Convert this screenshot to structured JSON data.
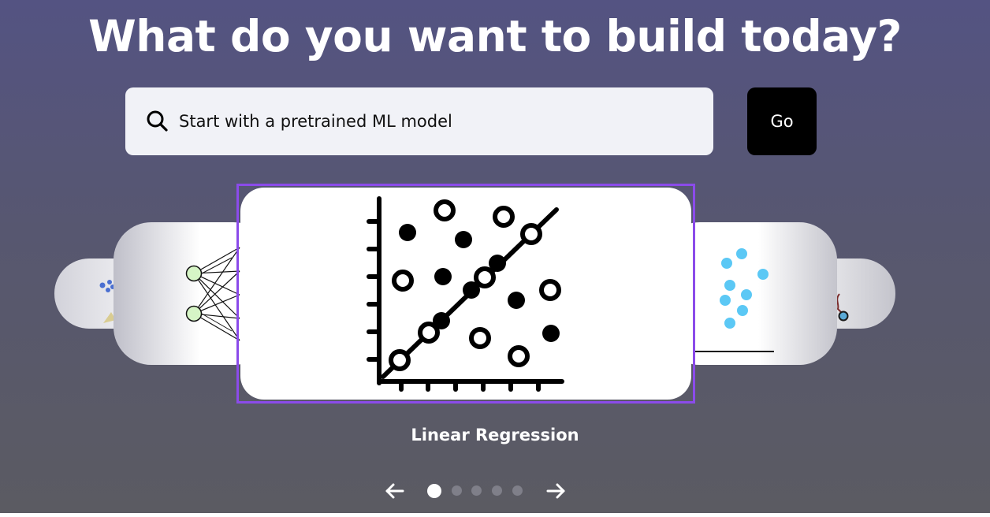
{
  "hero": {
    "headline": "What do you want to build today?"
  },
  "search": {
    "icon": "search-icon",
    "value": "Start with a pretrained ML model",
    "go_label": "Go"
  },
  "carousel": {
    "active_title": "Linear Regression",
    "active_index": 1,
    "total_slides": 5,
    "accent_color": "#8b4bea",
    "prev_icon": "arrow-left-icon",
    "next_icon": "arrow-right-icon",
    "dots": [
      {
        "active": true
      },
      {
        "active": false
      },
      {
        "active": false
      },
      {
        "active": false
      },
      {
        "active": false
      }
    ]
  },
  "colors": {
    "background_top": "#545382",
    "background_bottom": "#5b5b62",
    "go_button": "#000000",
    "search_box": "#f1f2f7",
    "node_fill": "#d6f5c6",
    "cluster_point": "#5bc8f5"
  }
}
